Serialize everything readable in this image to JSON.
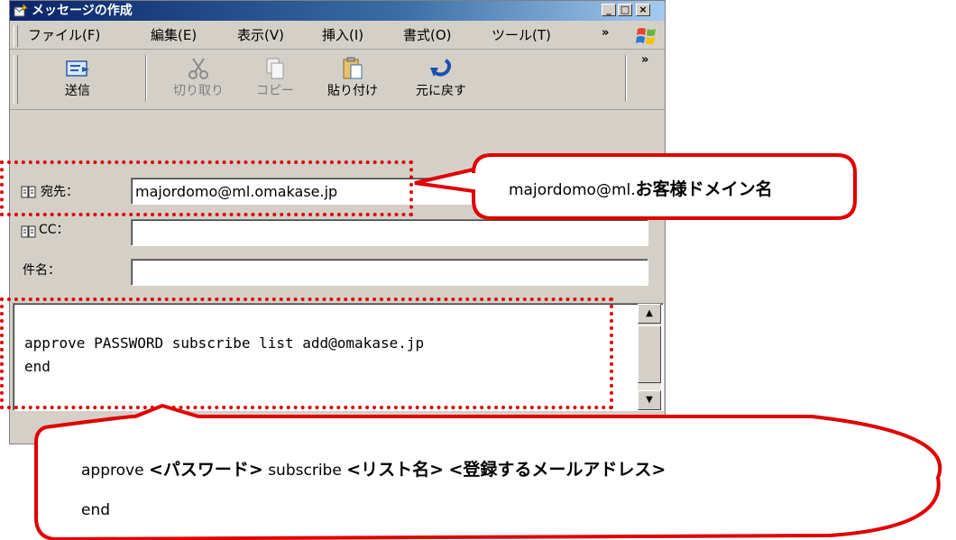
{
  "window": {
    "title": "メッセージの作成",
    "controls": {
      "minimize": "_",
      "maximize": "□",
      "close": "×"
    }
  },
  "menu": {
    "items": [
      "ファイル(F)",
      "編集(E)",
      "表示(V)",
      "挿入(I)",
      "書式(O)",
      "ツール(T)"
    ],
    "more": "»"
  },
  "toolbar": {
    "send": "送信",
    "cut": "切り取り",
    "copy": "コピー",
    "paste": "貼り付け",
    "undo": "元に戻す",
    "more": "»"
  },
  "fields": {
    "to_label": "宛先：",
    "to_value": "majordomo@ml.omakase.jp",
    "cc_label": "CC：",
    "cc_value": "",
    "subject_label": "件名：",
    "subject_value": ""
  },
  "body": {
    "lines": [
      "approve PASSWORD subscribe list add@omakase.jp",
      "end"
    ]
  },
  "callouts": {
    "address_plain": "majordomo@ml.",
    "address_bold": "お客様ドメイン名",
    "command_approve": "approve ",
    "command_password": "<パスワード>",
    "command_subscribe": " subscribe ",
    "command_list": "<リスト名>",
    "command_space": " ",
    "command_address": "<登録するメールアドレス>",
    "command_end": "end"
  },
  "colors": {
    "annotation": "#e00000",
    "titlebar": "#0a246a",
    "window_face": "#d4d0c8"
  }
}
